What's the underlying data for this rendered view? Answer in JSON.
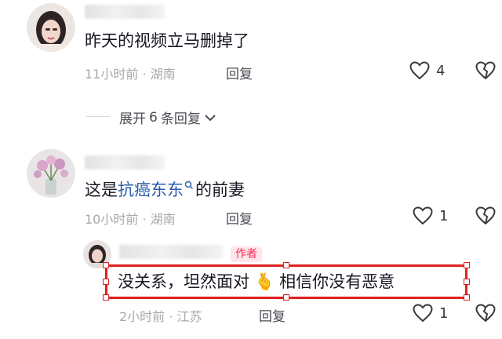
{
  "comments": [
    {
      "text": "昨天的视频立马删掉了",
      "time": "11小时前",
      "location": "湖南",
      "reply_label": "回复",
      "likes": "4",
      "expand_label": "展开",
      "expand_count": "6",
      "expand_suffix": "条回复"
    },
    {
      "text_prefix": "这是",
      "link": "抗癌东东",
      "text_suffix": "的前妻",
      "time": "10小时前",
      "location": "湖南",
      "reply_label": "回复",
      "likes": "1"
    }
  ],
  "reply": {
    "badge": "作者",
    "text_before": "没关系，坦然面对",
    "emoji": "🫰",
    "text_after": "相信你没有恶意",
    "time": "2小时前",
    "location": "江苏",
    "reply_label": "回复",
    "likes": "1"
  },
  "colors": {
    "link": "#2a5caa",
    "badge": "#fe2c55",
    "highlight": "#e02020"
  }
}
